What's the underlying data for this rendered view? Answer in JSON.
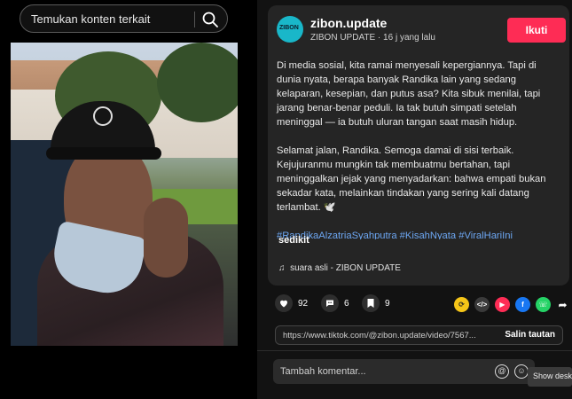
{
  "search": {
    "placeholder": "Temukan konten terkait",
    "icon": "search-icon"
  },
  "post": {
    "author": "zibon.update",
    "avatar_text": "ZIBON",
    "subline": "ZIBON UPDATE · 16 j yang lalu",
    "follow_label": "Ikuti",
    "paragraph1": "Di media sosial, kita ramai menyesali kepergiannya. Tapi di dunia nyata, berapa banyak Randika lain yang sedang kelaparan, kesepian, dan putus asa? Kita sibuk menilai, tapi jarang benar-benar peduli. Ia tak butuh simpati setelah meninggal — ia butuh uluran tangan saat masih hidup.",
    "paragraph2": "Selamat jalan, Randika. Semoga damai di sisi terbaik. Kejujuranmu mungkin tak membuatmu bertahan, tapi meninggalkan jejak yang menyadarkan: bahwa empati bukan sekadar kata, melainkan tindakan yang sering kali datang terlambat. 🕊️",
    "hashtags": "#RandikaAlzatriaSyahputra #KisahNyata #ViralHariIni",
    "more_label": "sedikit",
    "music": "suara asli - ZIBON UPDATE"
  },
  "stats": {
    "likes": "92",
    "comments": "6",
    "saves": "9"
  },
  "share": {
    "url": "https://www.tiktok.com/@zibon.update/video/7567...",
    "copy_label": "Salin tautan"
  },
  "comment": {
    "placeholder": "Tambah komentar..."
  },
  "tooltip": "Show desktop",
  "colors": {
    "accent": "#fe2c55",
    "hashtag": "#6da7f3",
    "panel": "#252525"
  }
}
